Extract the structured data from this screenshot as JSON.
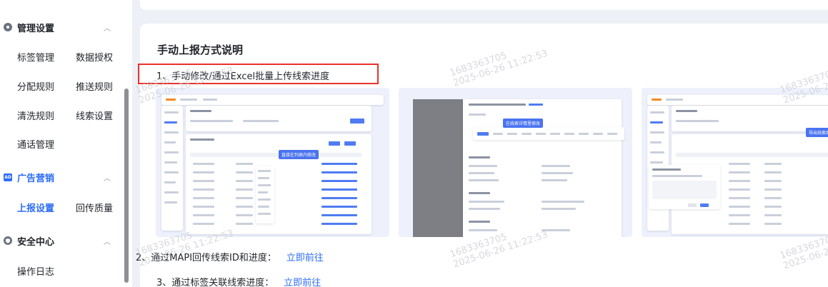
{
  "sidebar": {
    "sections": [
      {
        "label": "管理设置",
        "icon": "gear-icon"
      },
      {
        "label": "广告营销",
        "icon": "ad-icon",
        "badge": "AD"
      },
      {
        "label": "安全中心",
        "icon": "shield-icon"
      }
    ],
    "items": [
      "标签管理",
      "数据授权",
      "分配规则",
      "推送规则",
      "清洗规则",
      "线索设置",
      "通话管理",
      "上报设置",
      "回传质量",
      "操作日志"
    ]
  },
  "main": {
    "title": "手动上报方式说明",
    "steps": [
      {
        "text": "1、手动修改/通过Excel批量上传线索进度"
      },
      {
        "text": "2、通过MAPI回传线索ID和进度：",
        "link": "立即前往"
      },
      {
        "text": "3、通过标签关联线索进度：",
        "link": "立即前往"
      }
    ],
    "screens": [
      {
        "tip": "直接在列表内修改"
      },
      {
        "tip": "在线索详情里修改"
      },
      {
        "tip": "导出线索后批量上传"
      }
    ]
  },
  "watermark": {
    "id": "1683363705",
    "date": "2025-06-26 11:22:53"
  }
}
